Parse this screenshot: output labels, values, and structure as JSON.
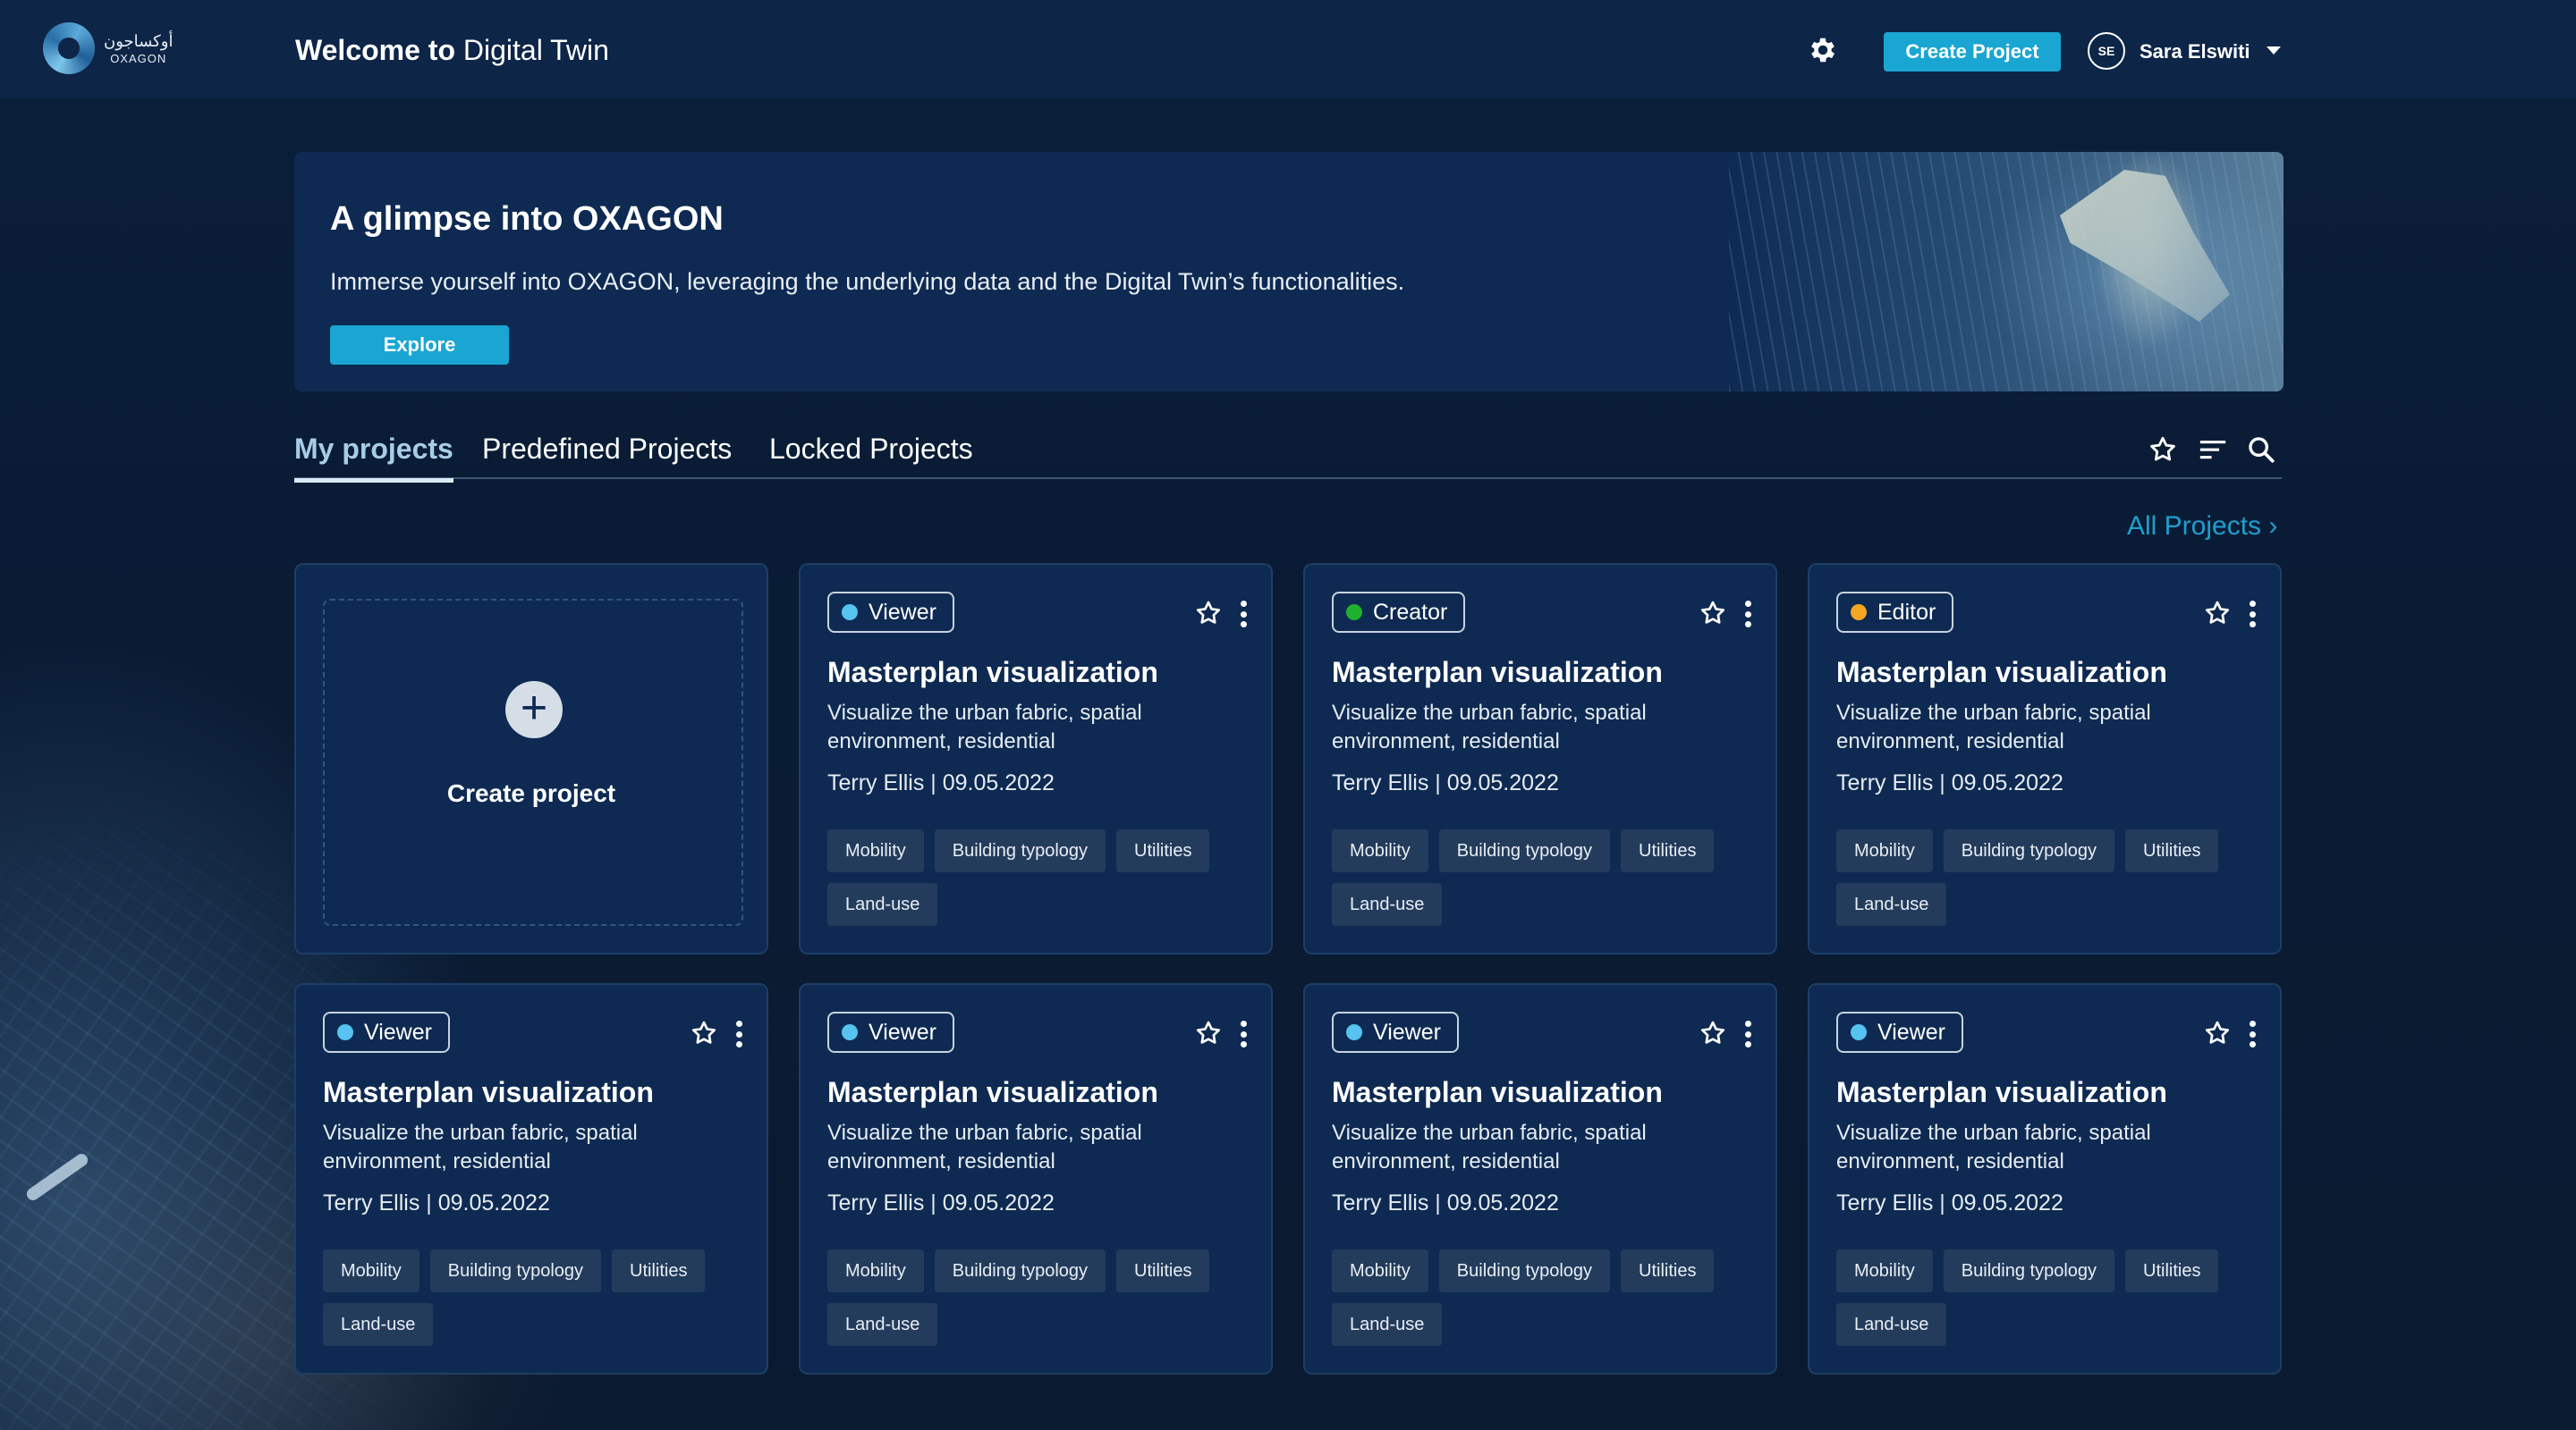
{
  "brand": {
    "arabic": "أوكساجون",
    "english": "OXAGON"
  },
  "header": {
    "welcome_bold": "Welcome to",
    "welcome_light": "Digital Twin",
    "create_button": "Create Project",
    "user_initials": "SE",
    "user_name": "Sara Elswiti"
  },
  "banner": {
    "title": "A glimpse into OXAGON",
    "text": "Immerse yourself into OXAGON, leveraging the underlying data and the Digital Twin’s functionalities.",
    "button": "Explore"
  },
  "tabs": [
    "My projects",
    "Predefined Projects",
    "Locked Projects"
  ],
  "active_tab": "My projects",
  "all_projects_link": "All Projects ›",
  "create_card": {
    "label": "Create project",
    "plus": "+"
  },
  "role_colors": {
    "Viewer": "#56c3f0",
    "Creator": "#1fb02e",
    "Editor": "#f5a623"
  },
  "projects": [
    {
      "role": "Viewer",
      "title": "Masterplan visualization",
      "desc": "Visualize the urban fabric, spatial environment, residential",
      "meta": "Terry Ellis  |  09.05.2022",
      "tags": [
        "Mobility",
        "Building typology",
        "Utilities",
        "Land-use"
      ]
    },
    {
      "role": "Creator",
      "title": "Masterplan visualization",
      "desc": "Visualize the urban fabric, spatial environment, residential",
      "meta": "Terry Ellis  |  09.05.2022",
      "tags": [
        "Mobility",
        "Building typology",
        "Utilities",
        "Land-use"
      ]
    },
    {
      "role": "Editor",
      "title": "Masterplan visualization",
      "desc": "Visualize the urban fabric, spatial environment, residential",
      "meta": "Terry Ellis  |  09.05.2022",
      "tags": [
        "Mobility",
        "Building typology",
        "Utilities",
        "Land-use"
      ]
    },
    {
      "role": "Viewer",
      "title": "Masterplan visualization",
      "desc": "Visualize the urban fabric, spatial environment, residential",
      "meta": "Terry Ellis  |  09.05.2022",
      "tags": [
        "Mobility",
        "Building typology",
        "Utilities",
        "Land-use"
      ]
    },
    {
      "role": "Viewer",
      "title": "Masterplan visualization",
      "desc": "Visualize the urban fabric, spatial environment, residential",
      "meta": "Terry Ellis  |  09.05.2022",
      "tags": [
        "Mobility",
        "Building typology",
        "Utilities",
        "Land-use"
      ]
    },
    {
      "role": "Viewer",
      "title": "Masterplan visualization",
      "desc": "Visualize the urban fabric, spatial environment, residential",
      "meta": "Terry Ellis  |  09.05.2022",
      "tags": [
        "Mobility",
        "Building typology",
        "Utilities",
        "Land-use"
      ]
    },
    {
      "role": "Viewer",
      "title": "Masterplan visualization",
      "desc": "Visualize the urban fabric, spatial environment, residential",
      "meta": "Terry Ellis  |  09.05.2022",
      "tags": [
        "Mobility",
        "Building typology",
        "Utilities",
        "Land-use"
      ]
    }
  ],
  "icons": {
    "settings": "gear-icon",
    "favorite": "star-icon",
    "sort": "sort-icon",
    "search": "search-icon",
    "more": "kebab-menu-icon"
  }
}
